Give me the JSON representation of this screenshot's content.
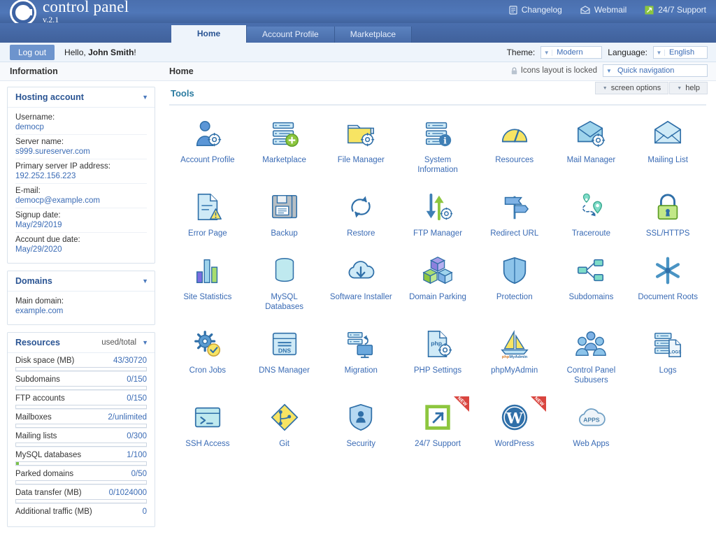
{
  "brand": {
    "title": "control panel",
    "version": "v.2.1",
    "logo_icon": "circle-c-logo"
  },
  "header": {
    "links": [
      {
        "label": "Changelog",
        "icon": "document-icon"
      },
      {
        "label": "Webmail",
        "icon": "envelope-icon"
      },
      {
        "label": "24/7 Support",
        "icon": "support-square-icon"
      }
    ]
  },
  "tabs": [
    {
      "label": "Home",
      "active": true
    },
    {
      "label": "Account Profile",
      "active": false
    },
    {
      "label": "Marketplace",
      "active": false
    }
  ],
  "userbar": {
    "logout_label": "Log out",
    "greeting_prefix": "Hello, ",
    "user_name": "John Smith",
    "greeting_suffix": "!",
    "theme_label": "Theme:",
    "theme_value": "Modern",
    "language_label": "Language:",
    "language_value": "English"
  },
  "subbar": {
    "information_title": "Information",
    "page_title": "Home",
    "locked_text": "Icons layout is locked",
    "lock_icon": "lock-icon",
    "quick_nav_value": "Quick navigation",
    "screen_options_label": "screen options",
    "help_label": "help"
  },
  "sidebar": {
    "hosting": {
      "title": "Hosting account",
      "fields": [
        {
          "label": "Username:",
          "value": "democp"
        },
        {
          "label": "Server name:",
          "value": "s999.sureserver.com"
        },
        {
          "label": "Primary server IP address:",
          "value": "192.252.156.223"
        },
        {
          "label": "E-mail:",
          "value": "democp@example.com"
        },
        {
          "label": "Signup date:",
          "value": "May/29/2019"
        },
        {
          "label": "Account due date:",
          "value": "May/29/2020"
        }
      ]
    },
    "domains": {
      "title": "Domains",
      "fields": [
        {
          "label": "Main domain:",
          "value": "example.com"
        }
      ]
    },
    "resources": {
      "title": "Resources",
      "subtitle": "used/total",
      "rows": [
        {
          "label": "Disk space (MB)",
          "value": "43/30720",
          "percent": 0,
          "bar": true
        },
        {
          "label": "Subdomains",
          "value": "0/150",
          "percent": 0,
          "bar": true
        },
        {
          "label": "FTP accounts",
          "value": "0/150",
          "percent": 0,
          "bar": true
        },
        {
          "label": "Mailboxes",
          "value": "2/unlimited",
          "percent": 0,
          "bar": true
        },
        {
          "label": "Mailing lists",
          "value": "0/300",
          "percent": 0,
          "bar": true
        },
        {
          "label": "MySQL databases",
          "value": "1/100",
          "percent": 2,
          "bar": true
        },
        {
          "label": "Parked domains",
          "value": "0/50",
          "percent": 0,
          "bar": true
        },
        {
          "label": "Data transfer (MB)",
          "value": "0/1024000",
          "percent": 0,
          "bar": true
        },
        {
          "label": "Additional traffic (MB)",
          "value": "0",
          "percent": 0,
          "bar": false
        }
      ]
    }
  },
  "tools": {
    "section_title": "Tools",
    "new_badge_label": "NEW",
    "items": [
      {
        "label": "Account Profile",
        "icon": "user-gear-icon",
        "new": false
      },
      {
        "label": "Marketplace",
        "icon": "server-plus-icon",
        "new": false
      },
      {
        "label": "File Manager",
        "icon": "folder-gear-icon",
        "new": false
      },
      {
        "label": "System Information",
        "icon": "server-info-icon",
        "new": false
      },
      {
        "label": "Resources",
        "icon": "gauge-icon",
        "new": false
      },
      {
        "label": "Mail Manager",
        "icon": "mail-gear-icon",
        "new": false
      },
      {
        "label": "Mailing List",
        "icon": "envelope-icon",
        "new": false
      },
      {
        "label": "Error Page",
        "icon": "document-warning-icon",
        "new": false
      },
      {
        "label": "Backup",
        "icon": "floppy-disk-icon",
        "new": false
      },
      {
        "label": "Restore",
        "icon": "refresh-arrows-icon",
        "new": false
      },
      {
        "label": "FTP Manager",
        "icon": "updown-arrows-gear-icon",
        "new": false
      },
      {
        "label": "Redirect URL",
        "icon": "signpost-icon",
        "new": false
      },
      {
        "label": "Traceroute",
        "icon": "map-pins-path-icon",
        "new": false
      },
      {
        "label": "SSL/HTTPS",
        "icon": "padlock-icon",
        "new": false
      },
      {
        "label": "Site Statistics",
        "icon": "bar-chart-icon",
        "new": false
      },
      {
        "label": "MySQL Databases",
        "icon": "database-icon",
        "new": false
      },
      {
        "label": "Software Installer",
        "icon": "cloud-download-icon",
        "new": false
      },
      {
        "label": "Domain Parking",
        "icon": "cubes-icon",
        "new": false
      },
      {
        "label": "Protection",
        "icon": "shield-icon",
        "new": false
      },
      {
        "label": "Subdomains",
        "icon": "node-tree-icon",
        "new": false
      },
      {
        "label": "Document Roots",
        "icon": "asterisk-star-icon",
        "new": false
      },
      {
        "label": "Cron Jobs",
        "icon": "gear-clock-icon",
        "new": false
      },
      {
        "label": "DNS Manager",
        "icon": "dns-window-icon",
        "new": false
      },
      {
        "label": "Migration",
        "icon": "server-monitor-arrow-icon",
        "new": false
      },
      {
        "label": "PHP Settings",
        "icon": "php-gear-icon",
        "new": false
      },
      {
        "label": "phpMyAdmin",
        "icon": "phpmyadmin-sailboat-icon",
        "new": false
      },
      {
        "label": "Control Panel Subusers",
        "icon": "users-group-icon",
        "new": false
      },
      {
        "label": "Logs",
        "icon": "server-logs-icon",
        "new": false
      },
      {
        "label": "SSH Access",
        "icon": "terminal-icon",
        "new": false
      },
      {
        "label": "Git",
        "icon": "git-branch-diamond-icon",
        "new": false
      },
      {
        "label": "Security",
        "icon": "shield-user-icon",
        "new": false
      },
      {
        "label": "24/7 Support",
        "icon": "support-square-icon",
        "new": true
      },
      {
        "label": "WordPress",
        "icon": "wordpress-icon",
        "new": true
      },
      {
        "label": "Web Apps",
        "icon": "cloud-apps-icon",
        "new": false
      }
    ]
  }
}
